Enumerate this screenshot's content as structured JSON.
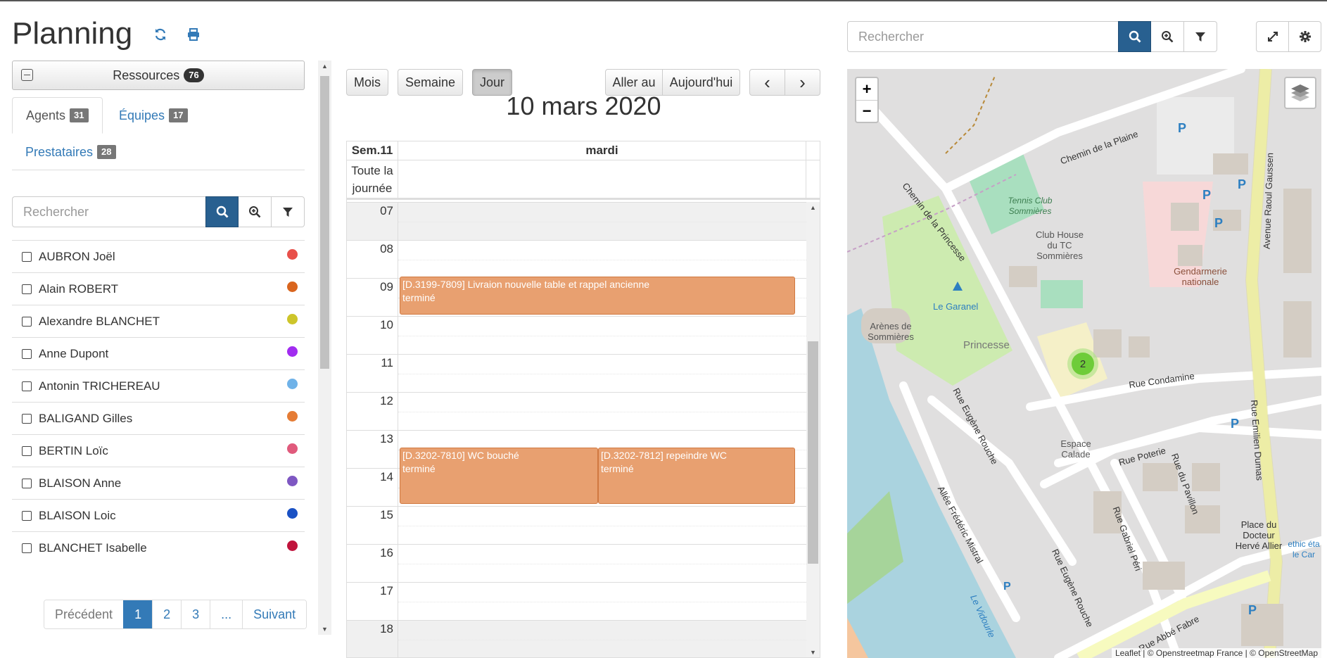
{
  "header": {
    "title": "Planning"
  },
  "sidebar": {
    "resources_label": "Ressources",
    "resources_count": "76",
    "tabs": [
      {
        "label": "Agents",
        "count": "31"
      },
      {
        "label": "Équipes",
        "count": "17"
      },
      {
        "label": "Prestataires",
        "count": "28"
      }
    ],
    "search_placeholder": "Rechercher",
    "resources": [
      {
        "name": "AUBRON Joël",
        "color": "#e8504a"
      },
      {
        "name": "Alain ROBERT",
        "color": "#d9651e"
      },
      {
        "name": "Alexandre BLANCHET",
        "color": "#cdc52a"
      },
      {
        "name": "Anne Dupont",
        "color": "#a12cf0"
      },
      {
        "name": "Antonin TRICHEREAU",
        "color": "#6fb2e8"
      },
      {
        "name": "BALIGAND Gilles",
        "color": "#e57c35"
      },
      {
        "name": "BERTIN Loïc",
        "color": "#e05a7c"
      },
      {
        "name": "BLAISON Anne",
        "color": "#7e57c2"
      },
      {
        "name": "BLAISON Loic",
        "color": "#1a51c4"
      },
      {
        "name": "BLANCHET Isabelle",
        "color": "#c0143c"
      }
    ],
    "pagination": {
      "prev": "Précédent",
      "pages": [
        "1",
        "2",
        "3",
        "..."
      ],
      "next": "Suivant"
    }
  },
  "calendar": {
    "views": {
      "month": "Mois",
      "week": "Semaine",
      "day": "Jour"
    },
    "goto": "Aller au",
    "today": "Aujourd'hui",
    "prev": "‹",
    "next": "›",
    "title": "10 mars 2020",
    "week_label": "Sem.11",
    "day_label": "mardi",
    "allday_label": "Toute la journée",
    "hours": [
      "07",
      "08",
      "09",
      "10",
      "11",
      "12",
      "13",
      "14",
      "15",
      "16",
      "17",
      "18"
    ],
    "events": [
      {
        "title": "[D.3199-7809] Livraion nouvelle table et rappel ancienne",
        "status": "terminé"
      },
      {
        "title": "[D.3202-7810] WC bouché",
        "status": "terminé"
      },
      {
        "title": "[D.3202-7812] repeindre WC",
        "status": "terminé"
      }
    ]
  },
  "map": {
    "search_placeholder": "Rechercher",
    "zoom_in": "+",
    "zoom_out": "−",
    "cluster_count": "2",
    "attribution": "Leaflet | © Openstreetmap France | © OpenStreetMap",
    "labels": {
      "chemin_plaine": "Chemin de la Plaine",
      "chemin_princesse": "Chemin de la Princesse",
      "tennis": "Tennis Club Sommières",
      "club_house": "Club House du TC Sommières",
      "garanel": "Le Garanel",
      "arenes": "Arènes de Sommières",
      "princesse": "Princesse",
      "gendarmerie": "Gendarmerie nationale",
      "raoul": "Avenue Raoul Gaussen",
      "condamine": "Rue Condamine",
      "eugene_rouche": "Rue Eugène Rouche",
      "espace_calade": "Espace Calade",
      "poterie": "Rue Poterie",
      "pavillon": "Rue du Pavillon",
      "emilien_dumas": "Rue Emilien Dumas",
      "gabriel_peri": "Rue Gabriel Péri",
      "mistral": "Allée Frédéric Mistral",
      "vidourle": "Le Vidourle",
      "place": "Place du Docteur Hervé Allier",
      "abbe_fabre": "Rue Abbé Fabre",
      "ethic": "ethic éta le Car"
    }
  }
}
